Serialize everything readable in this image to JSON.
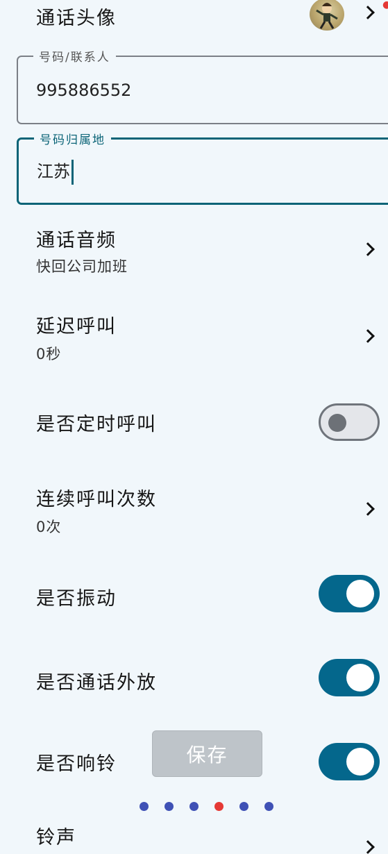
{
  "avatar_row": {
    "label": "通话头像"
  },
  "number_field": {
    "label": "号码/联系人",
    "value": "995886552"
  },
  "location_field": {
    "label": "号码归属地",
    "value": "江苏"
  },
  "audio_row": {
    "label": "通话音频",
    "value": "快回公司加班"
  },
  "delay_row": {
    "label": "延迟呼叫",
    "value": "0秒"
  },
  "scheduled_row": {
    "label": "是否定时呼叫",
    "enabled": false
  },
  "repeat_row": {
    "label": "连续呼叫次数",
    "value": "0次"
  },
  "vibrate_row": {
    "label": "是否振动",
    "enabled": true
  },
  "speaker_row": {
    "label": "是否通话外放",
    "enabled": true
  },
  "ring_row": {
    "label": "是否响铃",
    "enabled": true
  },
  "ringtone_row": {
    "label": "铃声"
  },
  "save_button": {
    "label": "保存"
  },
  "pager": {
    "count": 6,
    "active_index": 3
  },
  "colors": {
    "accent": "#04678c",
    "focus": "#0b6477",
    "dot": "#3f51b5",
    "dot_active": "#e53935",
    "background": "#f1f7fb"
  }
}
